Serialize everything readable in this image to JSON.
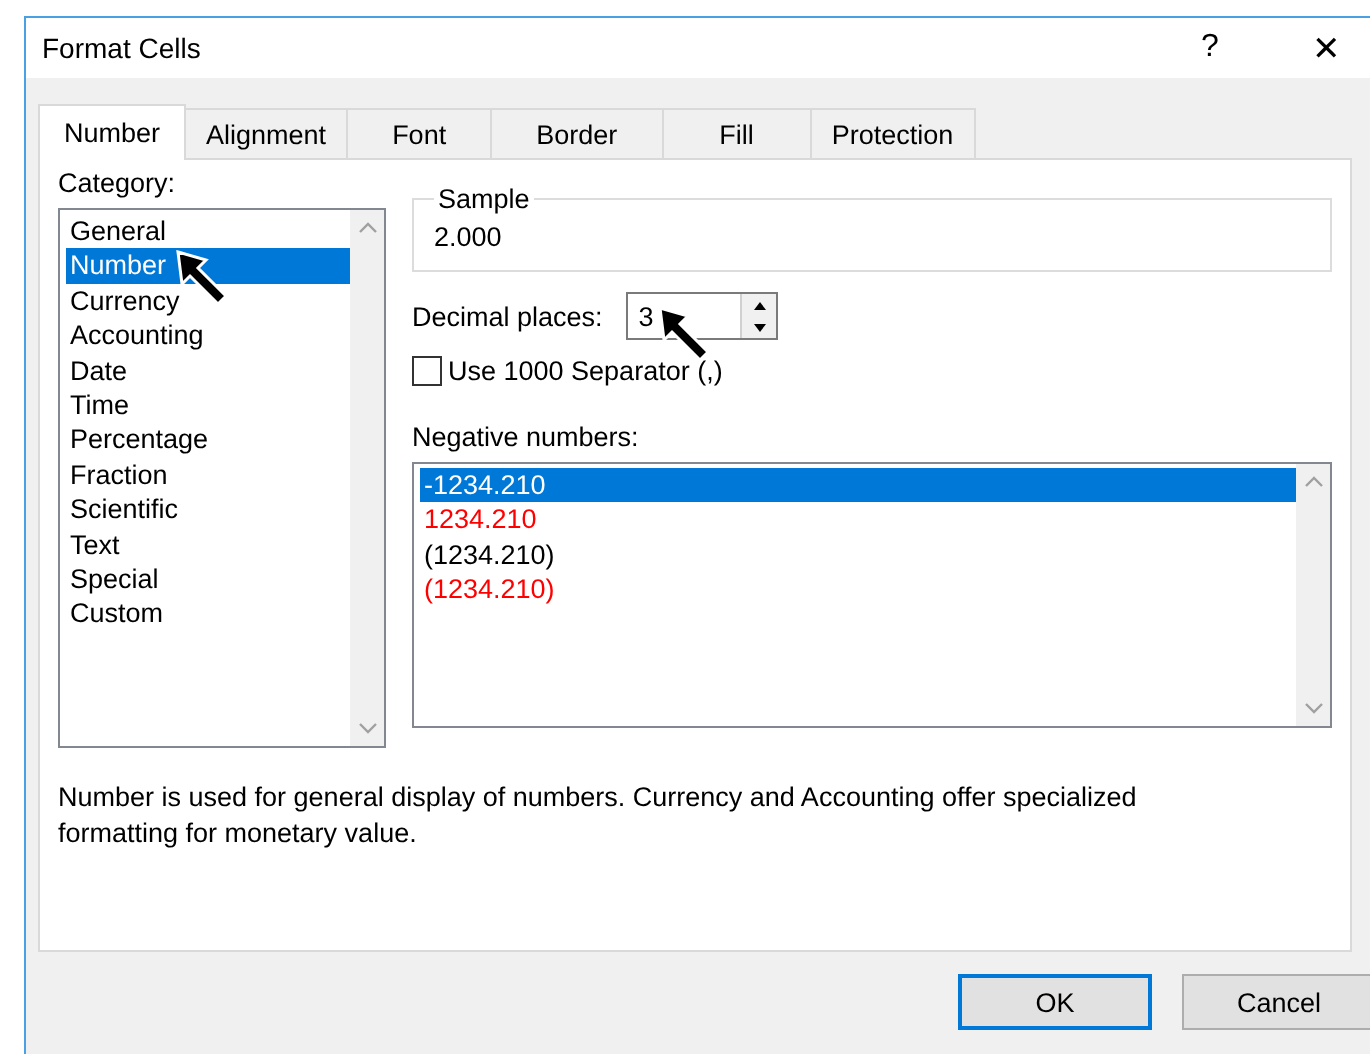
{
  "window": {
    "title": "Format Cells",
    "help": "?",
    "close": "✕"
  },
  "tabs": [
    {
      "label": "Number",
      "selected": true
    },
    {
      "label": "Alignment",
      "selected": false
    },
    {
      "label": "Font",
      "selected": false
    },
    {
      "label": "Border",
      "selected": false
    },
    {
      "label": "Fill",
      "selected": false
    },
    {
      "label": "Protection",
      "selected": false
    }
  ],
  "category": {
    "label": "Category:",
    "items": [
      {
        "label": "General",
        "selected": false
      },
      {
        "label": "Number",
        "selected": true
      },
      {
        "label": "Currency",
        "selected": false
      },
      {
        "label": "Accounting",
        "selected": false
      },
      {
        "label": "Date",
        "selected": false
      },
      {
        "label": "Time",
        "selected": false
      },
      {
        "label": "Percentage",
        "selected": false
      },
      {
        "label": "Fraction",
        "selected": false
      },
      {
        "label": "Scientific",
        "selected": false
      },
      {
        "label": "Text",
        "selected": false
      },
      {
        "label": "Special",
        "selected": false
      },
      {
        "label": "Custom",
        "selected": false
      }
    ]
  },
  "sample": {
    "label": "Sample",
    "value": "2.000"
  },
  "decimal_places": {
    "label": "Decimal places:",
    "value": "3"
  },
  "separator": {
    "label": "Use 1000 Separator (,)",
    "checked": false
  },
  "negative_numbers": {
    "label": "Negative numbers:",
    "items": [
      {
        "label": "-1234.210",
        "selected": true
      },
      {
        "label": "1234.210",
        "selected": false,
        "color": "#ff0000"
      },
      {
        "label": "(1234.210)",
        "selected": false,
        "color": "#000000"
      },
      {
        "label": "(1234.210)",
        "selected": false,
        "color": "#ff0000"
      }
    ]
  },
  "description": "Number is used for general display of numbers.  Currency and Accounting offer specialized formatting for monetary value.",
  "buttons": [
    {
      "label": "OK",
      "kind": "default"
    },
    {
      "label": "Cancel",
      "kind": "normal"
    }
  ]
}
